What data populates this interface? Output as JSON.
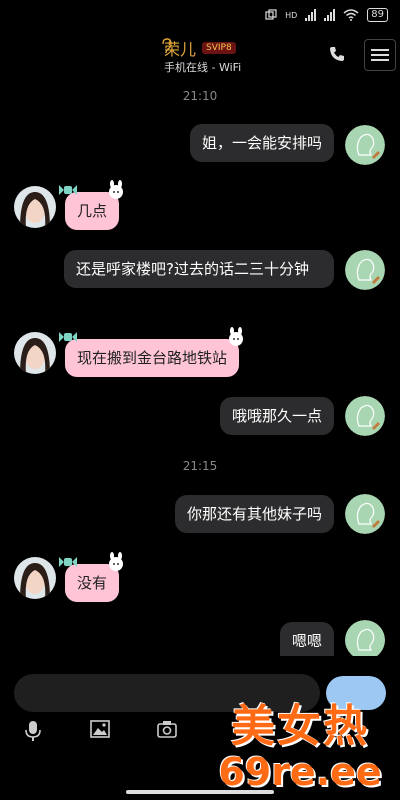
{
  "status_bar": {
    "hd_label": "HD",
    "battery": "89"
  },
  "header": {
    "contact_name": "荣儿",
    "vip_badge": "SVIP8",
    "online_status": "手机在线 - WiFi"
  },
  "chat": {
    "timestamps": [
      "21:10",
      "21:15"
    ],
    "messages": [
      {
        "from": "me",
        "text": "姐，一会能安排吗"
      },
      {
        "from": "contact",
        "text": "几点"
      },
      {
        "from": "me",
        "text": "还是呼家楼吧?过去的话二三十分钟"
      },
      {
        "from": "contact",
        "text": "现在搬到金台路地铁站"
      },
      {
        "from": "me",
        "text": "哦哦那久一点"
      },
      {
        "from": "me",
        "text": "你那还有其他妹子吗"
      },
      {
        "from": "contact",
        "text": "没有"
      },
      {
        "from": "me",
        "text": "嗯嗯"
      }
    ]
  },
  "input": {
    "placeholder": ""
  },
  "toolbar": {
    "icons": [
      "microphone-icon",
      "image-icon",
      "camera-icon"
    ]
  },
  "watermark": {
    "title": "美女热",
    "url": "69re.ee"
  },
  "colors": {
    "background": "#000000",
    "outgoing_bubble": "#2c2c2e",
    "incoming_bubble": "#ffc4d6",
    "contact_name": "#e0a53a",
    "send_button": "#9cc8f3",
    "watermark": "#ff6a14"
  }
}
